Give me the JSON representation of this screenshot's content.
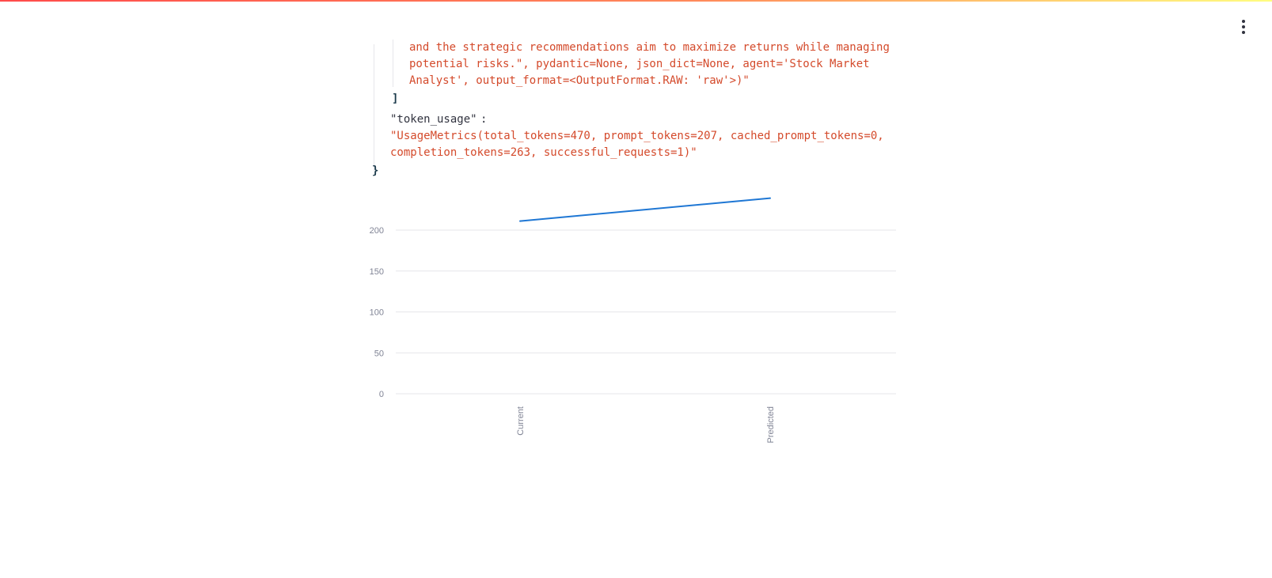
{
  "app": {
    "menu_icon": "kebab-menu-icon",
    "accent_gradient": [
      "#ff4b4b",
      "#fffd80"
    ]
  },
  "json_view": {
    "description_lines": [
      "and the strategic recommendations aim to maximize returns while managing",
      "potential risks.\", pydantic=None, json_dict=None, agent='Stock Market",
      "Analyst', output_format=<OutputFormat.RAW: 'raw'>)\""
    ],
    "array_close": "]",
    "token_usage_key": "\"token_usage\"",
    "colon": ":",
    "token_usage_lines": [
      "\"UsageMetrics(total_tokens=470, prompt_tokens=207, cached_prompt_tokens=0,",
      "completion_tokens=263, successful_requests=1)\""
    ],
    "object_close": "}"
  },
  "chart_data": {
    "type": "line",
    "categories": [
      "Current",
      "Predicted"
    ],
    "series": [
      {
        "values": [
          211,
          239
        ],
        "color": "#1f77d4"
      }
    ],
    "yticks": [
      "0",
      "50",
      "100",
      "150",
      "200"
    ],
    "ylim": [
      0,
      240
    ],
    "grid": true,
    "title": "",
    "xlabel": "",
    "ylabel": ""
  }
}
